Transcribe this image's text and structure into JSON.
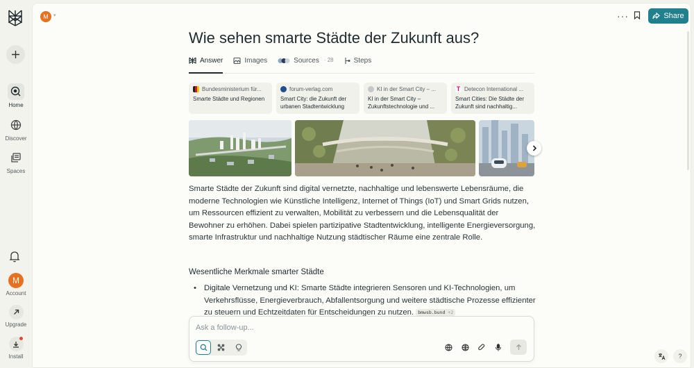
{
  "sidebar": {
    "nav": [
      {
        "label": "Home",
        "icon": "home-icon"
      },
      {
        "label": "Discover",
        "icon": "globe-icon"
      },
      {
        "label": "Spaces",
        "icon": "spaces-icon"
      }
    ],
    "account": {
      "initial": "M",
      "label": "Account"
    },
    "upgrade_label": "Upgrade",
    "install_label": "Install"
  },
  "topbar": {
    "avatar_initial": "M",
    "share_label": "Share"
  },
  "page": {
    "title": "Wie sehen smarte Städte der Zukunft aus?"
  },
  "tabs": [
    {
      "label": "Answer",
      "icon": "answer-icon"
    },
    {
      "label": "Images",
      "icon": "image-icon"
    },
    {
      "label": "Sources",
      "count": "· 28",
      "icon": "sources-icon"
    },
    {
      "label": "Steps",
      "icon": "steps-icon"
    }
  ],
  "sources": [
    {
      "site": "Bundesministerium für...",
      "title": "Smarte Städte und Regionen",
      "fav_color": "#c8202b"
    },
    {
      "site": "forum-verlag.com",
      "title": "Smart City: die Zukunft der urbanen Stadtentwicklung",
      "fav_color": "#1f4f8c"
    },
    {
      "site": "KI in der Smart City – ...",
      "title": "KI in der Smart City – Zukunftstechnologie und ...",
      "fav_color": "#9aa0a3"
    },
    {
      "site": "Detecon International ...",
      "title": "Smart Cities: Die Städte der Zukunft sind nachhaltig...",
      "fav_color": "#e20074"
    }
  ],
  "answer": {
    "intro": "Smarte Städte der Zukunft sind digital vernetzte, nachhaltige und lebenswerte Lebensräume, die moderne Technologien wie Künstliche Intelligenz, Internet of Things (IoT) und Smart Grids nutzen, um Ressourcen effizient zu verwalten, Mobilität zu verbessern und die Lebensqualität der Bewohner zu erhöhen. Dabei spielen partizipative Stadtentwicklung, intelligente Energieversorgung, smarte Infrastruktur und nachhaltige Nutzung städtischer Räume eine zentrale Rolle.",
    "section_heading": "Wesentliche Merkmale smarter Städte",
    "bullet_title": "Digitale Vernetzung und KI:",
    "bullet_text": " Smarte Städte integrieren Sensoren und KI-Technologien, um Verkehrsflüsse, Energieverbrauch, Abfallentsorgung und weitere städtische Prozesse effizienter zu steuern und Echtzeitdaten für Entscheidungen zu nutzen. ",
    "citation": "bmwsb.bund",
    "citation_more": "+2"
  },
  "followup": {
    "placeholder": "Ask a follow-up..."
  },
  "colors": {
    "accent": "#20808d",
    "avatar": "#e8711f",
    "page_bg": "#f3f3ee",
    "panel_bg": "#fcfcf9"
  }
}
